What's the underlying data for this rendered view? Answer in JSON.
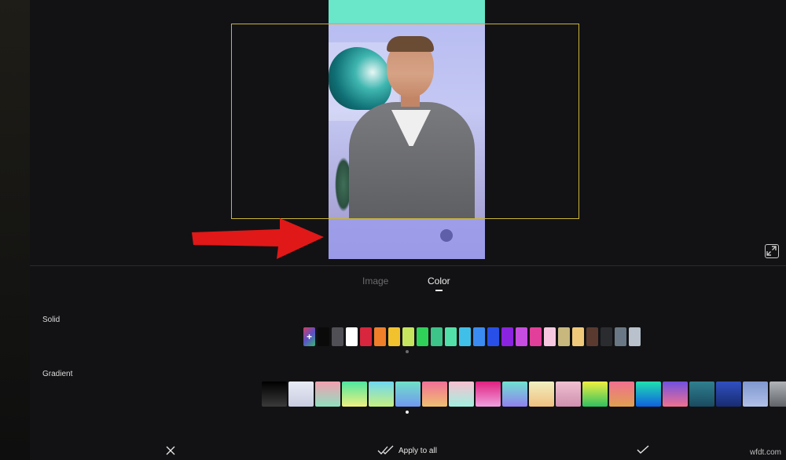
{
  "tabs": {
    "image_label": "Image",
    "color_label": "Color",
    "active": "Color"
  },
  "sections": {
    "solid_label": "Solid",
    "gradient_label": "Gradient"
  },
  "solid_colors": [
    "#0a0a0a",
    "#4f4f55",
    "#ffffff",
    "#d7263d",
    "#f07f2a",
    "#f2c12e",
    "#c7e45e",
    "#30d158",
    "#3cc489",
    "#52e0a8",
    "#40c0e8",
    "#3a8cf2",
    "#2850e8",
    "#8a24e0",
    "#c64de0",
    "#e23f9a",
    "#f6c9e0",
    "#c8b87e",
    "#f0c97a",
    "#5a3a2f",
    "#2b2c30",
    "#6a7784",
    "#b8c1cc"
  ],
  "gradients": [
    [
      "#000000",
      "#3a3a3a"
    ],
    [
      "#e8ecf6",
      "#c8ccdf"
    ],
    [
      "#f2a0b0",
      "#8ee0c0"
    ],
    [
      "#4ee6a0",
      "#f0f080"
    ],
    [
      "#6fd7f0",
      "#c6f080"
    ],
    [
      "#70e0c8",
      "#7098f0"
    ],
    [
      "#f07098",
      "#f0c070"
    ],
    [
      "#f8c0d0",
      "#a0f0e0"
    ],
    [
      "#e02080",
      "#f0a0e0"
    ],
    [
      "#70e0d0",
      "#9080f0"
    ],
    [
      "#f0f0c0",
      "#f0c080"
    ],
    [
      "#f0c0d0",
      "#d090b0"
    ],
    [
      "#f0f040",
      "#30c060"
    ],
    [
      "#f07090",
      "#e0a050"
    ],
    [
      "#20e0b0",
      "#1060e0"
    ],
    [
      "#7050e0",
      "#f07090"
    ],
    [
      "#2f8090",
      "#1a4a60"
    ],
    [
      "#3050c0",
      "#182c70"
    ],
    [
      "#8098d0",
      "#b0c0e8"
    ],
    [
      "#b0b4b8",
      "#606468"
    ]
  ],
  "bottom_bar": {
    "apply_all_label": "Apply to all"
  },
  "watermark": "wfdt.com",
  "colors": {
    "frame_outline": "#c9b436",
    "arrow": "#e01818",
    "active_tab": "#f0f0f0",
    "inactive_tab": "#6b6b70"
  },
  "icons": {
    "cancel": "close-icon",
    "apply_all": "double-check-icon",
    "confirm": "check-icon",
    "expand": "expand-icon",
    "add_color": "plus-icon"
  }
}
